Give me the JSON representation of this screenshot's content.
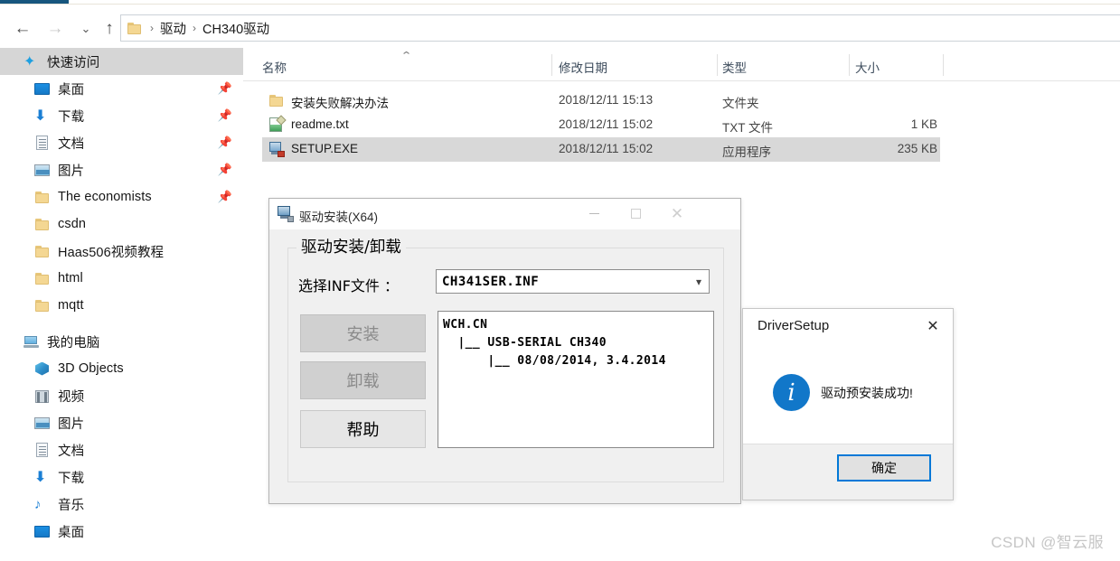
{
  "window": {
    "nav": {
      "back_icon": "arrow-left-icon",
      "forward_icon": "arrow-right-icon",
      "recent_icon": "chevron-down-icon",
      "up_icon": "arrow-up-icon"
    },
    "breadcrumb": {
      "folder_icon": "folder-icon",
      "separator": "›",
      "items": [
        "驱动",
        "CH340驱动"
      ]
    }
  },
  "sidebar": {
    "sections": [
      {
        "header": {
          "label": "快速访问",
          "icon": "star-pin-icon",
          "selected": true
        },
        "items": [
          {
            "label": "桌面",
            "icon": "desktop-icon",
            "pinned": true
          },
          {
            "label": "下载",
            "icon": "download-icon",
            "pinned": true
          },
          {
            "label": "文档",
            "icon": "document-icon",
            "pinned": true
          },
          {
            "label": "图片",
            "icon": "pictures-icon",
            "pinned": true
          },
          {
            "label": "The economists",
            "icon": "folder-icon",
            "pinned": true
          },
          {
            "label": "csdn",
            "icon": "folder-icon",
            "pinned": false
          },
          {
            "label": "Haas506视频教程",
            "icon": "folder-icon",
            "pinned": false
          },
          {
            "label": "html",
            "icon": "folder-icon",
            "pinned": false
          },
          {
            "label": "mqtt",
            "icon": "folder-icon",
            "pinned": false
          }
        ]
      },
      {
        "header": {
          "label": "我的电脑",
          "icon": "this-pc-icon",
          "selected": false
        },
        "items": [
          {
            "label": "3D Objects",
            "icon": "3d-objects-icon",
            "pinned": false
          },
          {
            "label": "视频",
            "icon": "videos-icon",
            "pinned": false
          },
          {
            "label": "图片",
            "icon": "pictures-icon",
            "pinned": false
          },
          {
            "label": "文档",
            "icon": "document-icon",
            "pinned": false
          },
          {
            "label": "下载",
            "icon": "download-icon",
            "pinned": false
          },
          {
            "label": "音乐",
            "icon": "music-icon",
            "pinned": false
          },
          {
            "label": "桌面",
            "icon": "desktop-icon",
            "pinned": false
          }
        ]
      }
    ],
    "pin_icon": "pin-icon"
  },
  "filelist": {
    "sort_indicator": "⌃",
    "columns": [
      "名称",
      "修改日期",
      "类型",
      "大小"
    ],
    "rows": [
      {
        "name": "安装失败解决办法",
        "date": "2018/12/11 15:13",
        "type": "文件夹",
        "size": "",
        "icon": "folder-icon",
        "selected": false
      },
      {
        "name": "readme.txt",
        "date": "2018/12/11 15:02",
        "type": "TXT 文件",
        "size": "1 KB",
        "icon": "text-file-icon",
        "selected": false
      },
      {
        "name": "SETUP.EXE",
        "date": "2018/12/11 15:02",
        "type": "应用程序",
        "size": "235 KB",
        "icon": "application-icon",
        "selected": true
      }
    ]
  },
  "driver_dialog": {
    "title": "驱动安装(X64)",
    "title_icon": "driver-setup-icon",
    "minimize_icon": "minimize-icon",
    "maximize_icon": "maximize-icon",
    "close_icon": "close-icon",
    "group_legend": "驱动安装/卸载",
    "inf_label": "选择INF文件 ：",
    "inf_value": "CH341SER.INF",
    "inf_dropdown_icon": "chevron-down-icon",
    "buttons": {
      "install": "安装",
      "uninstall": "卸载",
      "help": "帮助"
    },
    "log_lines": [
      "WCH.CN",
      "  |__ USB-SERIAL CH340",
      "      |__ 08/08/2014, 3.4.2014"
    ]
  },
  "message_box": {
    "title": "DriverSetup",
    "close_icon": "close-icon",
    "info_icon": "info-icon",
    "info_glyph": "i",
    "message": "驱动预安装成功!",
    "ok_button": "确定"
  },
  "watermark": {
    "text": "CSDN @智云服"
  },
  "colors": {
    "accent": "#0078d7",
    "tab_stub": "#17567e",
    "selection": "#d8d8d8",
    "info_blue": "#1177c9"
  }
}
